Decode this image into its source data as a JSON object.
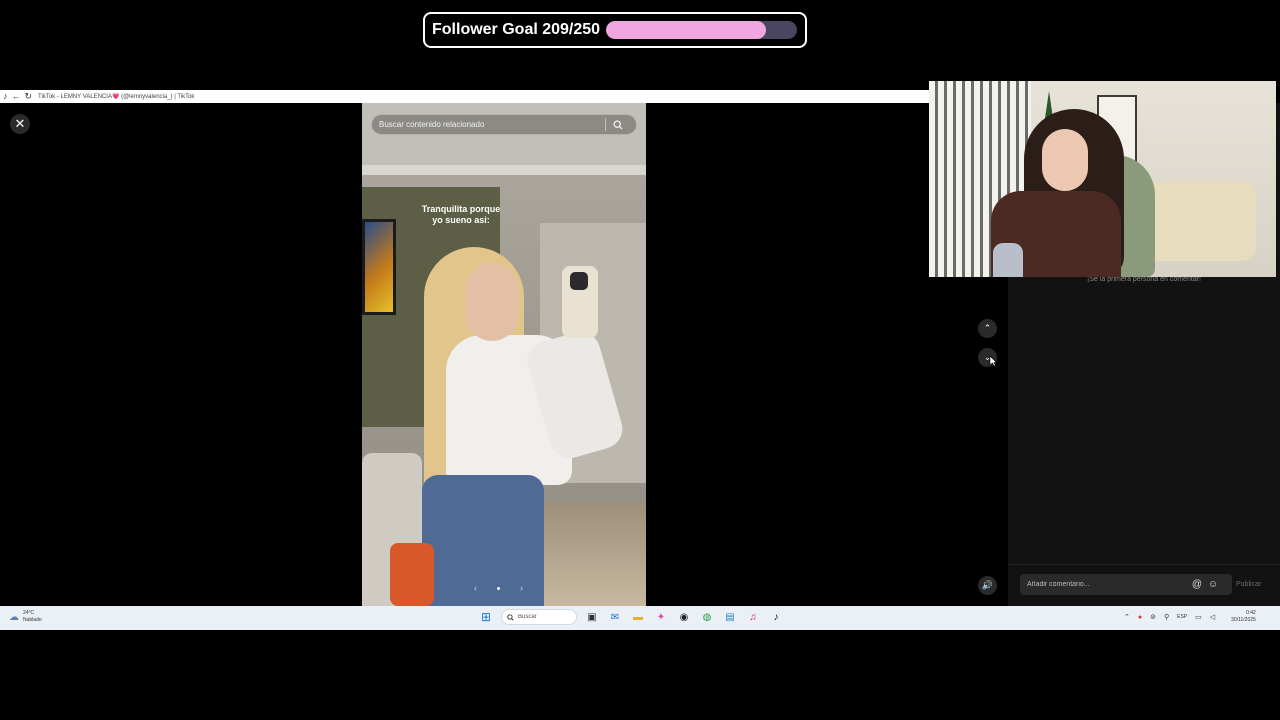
{
  "goal": {
    "label": "Follower Goal 209/250",
    "current": 209,
    "target": 250,
    "fill_color": "#f0a6e0"
  },
  "browser": {
    "tab_title": "TikTok - LEMNY VALENCIA💗 (@lemnyvalencia_) | TikTok",
    "icons": [
      "tiktok-icon",
      "back-arrow-icon",
      "reload-icon"
    ]
  },
  "video": {
    "caption_line1": "Tranquilita porque",
    "caption_line2": "yo sueno asi:",
    "search_placeholder": "Buscar contenido relacionado",
    "carousel_prev": "‹",
    "carousel_next": "›"
  },
  "viewer": {
    "close": "✕",
    "nav_up": "⌃",
    "nav_down": "⌄",
    "volume": "🔊"
  },
  "comments": {
    "empty_text": "¡Sé la primera persona en comentar!",
    "input_placeholder": "Añadir comentario...",
    "mention": "@",
    "emoji": "☺",
    "publish_label": "Publicar"
  },
  "taskbar": {
    "weather_temp": "24°C",
    "weather_desc": "Nublado",
    "search_placeholder": "Buscar",
    "language": "ESP",
    "time": "0:42",
    "date": "30/11/2025",
    "apps": [
      "task-view-icon",
      "outlook-icon",
      "file-explorer-icon",
      "copilot-icon",
      "app-icon",
      "chrome-icon",
      "notepad-icon",
      "tiktok-studio-icon",
      "tiktok-icon"
    ]
  }
}
